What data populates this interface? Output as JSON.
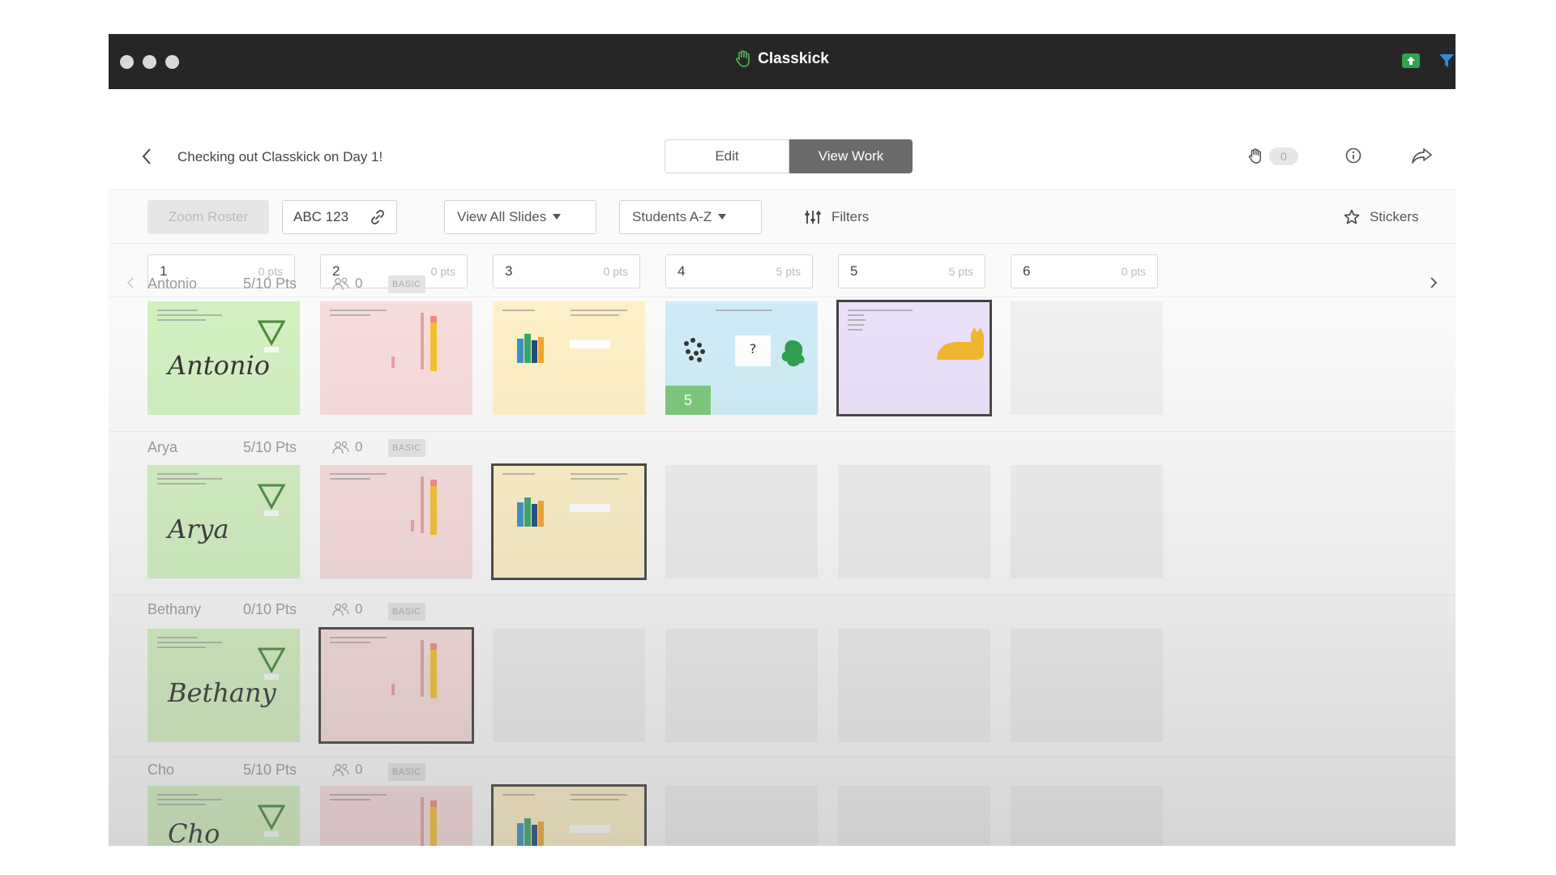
{
  "app": {
    "title": "Classkick"
  },
  "header": {
    "doc_title": "Checking out Classkick on Day 1!",
    "edit_label": "Edit",
    "view_work_label": "View Work",
    "hand_count": "0"
  },
  "toolbar": {
    "zoom_roster": "Zoom Roster",
    "access_code": "ABC 123",
    "view_slides": "View All Slides",
    "sort": "Students A-Z",
    "filters": "Filters",
    "stickers": "Stickers"
  },
  "slides": [
    {
      "num": "1",
      "pts": "0 pts"
    },
    {
      "num": "2",
      "pts": "0 pts"
    },
    {
      "num": "3",
      "pts": "0 pts"
    },
    {
      "num": "4",
      "pts": "5 pts"
    },
    {
      "num": "5",
      "pts": "5 pts"
    },
    {
      "num": "6",
      "pts": "0 pts"
    }
  ],
  "students": [
    {
      "name": "Antonio",
      "points": "5/10 Pts",
      "helpers": "0",
      "badge": "BASIC",
      "signature": "Antonio",
      "score_overlay": "5"
    },
    {
      "name": "Arya",
      "points": "5/10 Pts",
      "helpers": "0",
      "badge": "BASIC",
      "signature": "Arya"
    },
    {
      "name": "Bethany",
      "points": "0/10 Pts",
      "helpers": "0",
      "badge": "BASIC",
      "signature": "Bethany"
    },
    {
      "name": "Cho",
      "points": "5/10 Pts",
      "helpers": "0",
      "badge": "BASIC",
      "signature": "Cho"
    }
  ],
  "colors": {
    "titlebar": "#262626",
    "accent_green": "#4caf50",
    "view_work_bg": "#6b6b6b"
  },
  "icons": [
    "hand-icon",
    "back-chevron-icon",
    "info-icon",
    "share-icon",
    "link-icon",
    "filters-icon",
    "star-icon",
    "caret-down-icon",
    "chevron-right-icon",
    "upload-icon",
    "filter-funnel-icon"
  ]
}
